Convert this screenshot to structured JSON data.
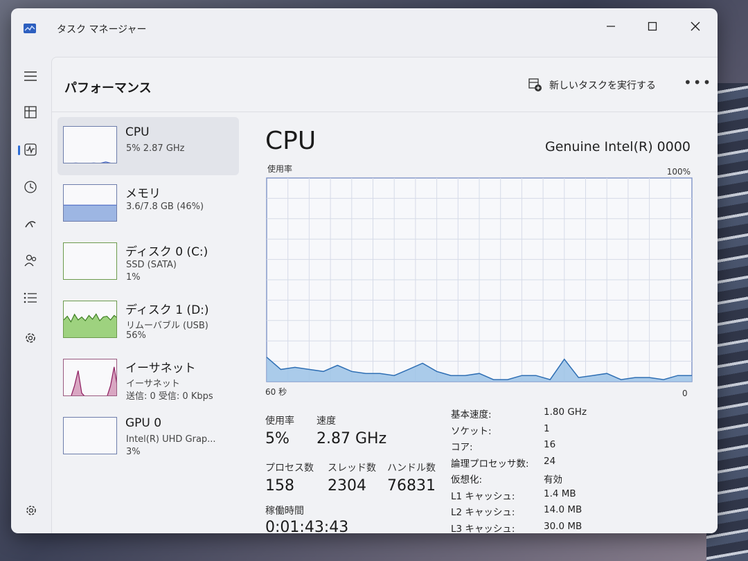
{
  "window": {
    "title": "タスク マネージャー"
  },
  "header": {
    "page_title": "パフォーマンス",
    "run_task_label": "新しいタスクを実行する",
    "more_label": "•••"
  },
  "sidebar": {
    "items": [
      {
        "name": "CPU",
        "line1": "5%  2.87 GHz",
        "line2": "",
        "color": "#4a69c5"
      },
      {
        "name": "メモリ",
        "line1": "3.6/7.8 GB (46%)",
        "line2": "",
        "color": "#4a69c5"
      },
      {
        "name": "ディスク 0 (C:)",
        "line1": "SSD (SATA)",
        "line2": "1%",
        "color": "#4a8d2e"
      },
      {
        "name": "ディスク 1 (D:)",
        "line1": "リムーバブル (USB)",
        "line2": "56%",
        "color": "#4a8d2e"
      },
      {
        "name": "イーサネット",
        "line1": "イーサネット",
        "line2": "送信: 0 受信: 0 Kbps",
        "color": "#8d1c5f"
      },
      {
        "name": "GPU 0",
        "line1": "Intel(R) UHD Grap...",
        "line2": "3%",
        "color": "#4a69c5"
      }
    ]
  },
  "main": {
    "title": "CPU",
    "model": "Genuine Intel(R) 0000",
    "usage_label": "使用率",
    "usage_max": "100%",
    "time_left": "60 秒",
    "time_right": "0",
    "stats": {
      "usage_label": "使用率",
      "usage_value": "5%",
      "speed_label": "速度",
      "speed_value": "2.87 GHz",
      "process_label": "プロセス数",
      "process_value": "158",
      "thread_label": "スレッド数",
      "thread_value": "2304",
      "handle_label": "ハンドル数",
      "handle_value": "76831",
      "uptime_label": "稼働時間",
      "uptime_value": "0:01:43:43"
    },
    "details": [
      {
        "key": "基本速度:",
        "value": "1.80 GHz"
      },
      {
        "key": "ソケット:",
        "value": "1"
      },
      {
        "key": "コア:",
        "value": "16"
      },
      {
        "key": "論理プロセッサ数:",
        "value": "24"
      },
      {
        "key": "仮想化:",
        "value": "有効"
      },
      {
        "key": "L1 キャッシュ:",
        "value": "1.4 MB"
      },
      {
        "key": "L2 キャッシュ:",
        "value": "14.0 MB"
      },
      {
        "key": "L3 キャッシュ:",
        "value": "30.0 MB"
      }
    ]
  },
  "chart_data": {
    "type": "area",
    "x": [
      60,
      58,
      56,
      54,
      52,
      50,
      48,
      46,
      44,
      42,
      40,
      38,
      36,
      34,
      32,
      30,
      28,
      26,
      24,
      22,
      20,
      18,
      16,
      14,
      12,
      10,
      8,
      6,
      4,
      2,
      0
    ],
    "values": [
      12,
      6,
      7,
      6,
      5,
      8,
      5,
      4,
      4,
      3,
      6,
      9,
      5,
      3,
      3,
      4,
      1,
      1,
      3,
      3,
      1,
      11,
      2,
      3,
      4,
      1,
      2,
      2,
      1,
      3,
      3
    ],
    "ylim": [
      0,
      100
    ],
    "grid": true,
    "color": "#4a8ac4"
  },
  "thumbs": {
    "cpu": [
      2,
      2,
      3,
      2,
      2,
      3,
      2,
      6,
      2,
      2
    ],
    "memory": [
      46,
      46,
      46,
      46,
      46,
      46,
      46,
      46,
      46,
      46
    ],
    "disk0": [
      0,
      0,
      0,
      0,
      1,
      0,
      0,
      0,
      0,
      0
    ],
    "disk1": [
      50,
      60,
      45,
      65,
      50,
      58,
      48,
      62,
      52,
      66,
      48,
      58,
      60,
      50,
      62,
      55
    ],
    "eth": [
      0,
      0,
      0,
      30,
      70,
      10,
      0,
      0,
      0,
      0,
      0,
      0,
      0,
      30,
      80,
      20
    ]
  }
}
